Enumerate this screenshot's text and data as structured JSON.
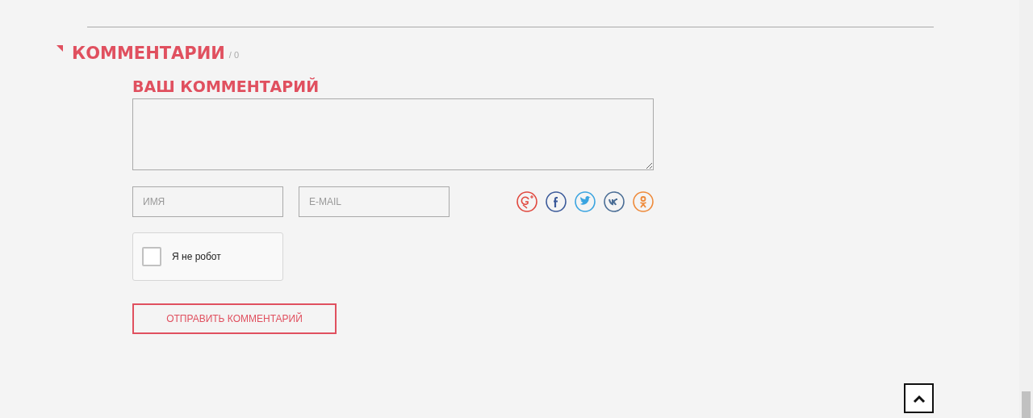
{
  "comments": {
    "title": "КОММЕНТАРИИ",
    "count": "/ 0"
  },
  "form": {
    "heading": "ВАШ КОММЕНТАРИЙ",
    "name_field": {
      "placeholder": "ИМЯ"
    },
    "email_field": {
      "placeholder": "E-MAIL"
    },
    "social": [
      {
        "kind": "googleplus",
        "color": "#e0483e"
      },
      {
        "kind": "facebook",
        "color": "#3b5a9a"
      },
      {
        "kind": "twitter",
        "color": "#3aa4e0"
      },
      {
        "kind": "vk",
        "color": "#4a6d95"
      },
      {
        "kind": "odnoklassniki",
        "color": "#ee8a3a"
      }
    ],
    "captcha": {
      "label": "Я не робот",
      "checked": false
    },
    "submit": "ОТПРАВИТЬ КОММЕНТАРИЙ"
  }
}
